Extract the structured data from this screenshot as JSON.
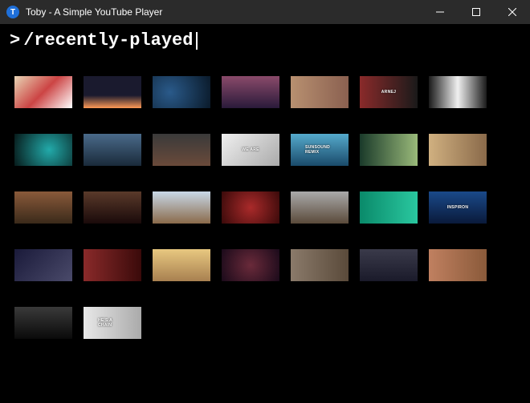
{
  "window": {
    "title": "Toby - A Simple YouTube Player",
    "icon_letter": "T"
  },
  "command": {
    "prompt": ">",
    "value": "/recently-played"
  },
  "thumbnails": [
    {
      "style": "s0",
      "overlay": ""
    },
    {
      "style": "s1",
      "overlay": ""
    },
    {
      "style": "s2",
      "overlay": ""
    },
    {
      "style": "s3",
      "overlay": ""
    },
    {
      "style": "s4",
      "overlay": ""
    },
    {
      "style": "s5",
      "overlay": "ARNEJ"
    },
    {
      "style": "s6",
      "overlay": ""
    },
    {
      "style": "s7",
      "overlay": ""
    },
    {
      "style": "s8",
      "overlay": ""
    },
    {
      "style": "s9",
      "overlay": ""
    },
    {
      "style": "s10",
      "overlay": "WE ARE"
    },
    {
      "style": "s11",
      "overlay": "SUNSOUND REMIX"
    },
    {
      "style": "s12",
      "overlay": ""
    },
    {
      "style": "s13",
      "overlay": ""
    },
    {
      "style": "s14",
      "overlay": ""
    },
    {
      "style": "s15",
      "overlay": ""
    },
    {
      "style": "s16",
      "overlay": ""
    },
    {
      "style": "s17",
      "overlay": ""
    },
    {
      "style": "s18",
      "overlay": ""
    },
    {
      "style": "s19",
      "overlay": ""
    },
    {
      "style": "s20",
      "overlay": "INSPIRON"
    },
    {
      "style": "s21",
      "overlay": ""
    },
    {
      "style": "s22",
      "overlay": ""
    },
    {
      "style": "s23",
      "overlay": ""
    },
    {
      "style": "s24",
      "overlay": ""
    },
    {
      "style": "s25",
      "overlay": ""
    },
    {
      "style": "s26",
      "overlay": ""
    },
    {
      "style": "s27",
      "overlay": ""
    },
    {
      "style": "s28",
      "overlay": ""
    },
    {
      "style": "s29",
      "overlay": "HE'S A CHAIN"
    }
  ]
}
